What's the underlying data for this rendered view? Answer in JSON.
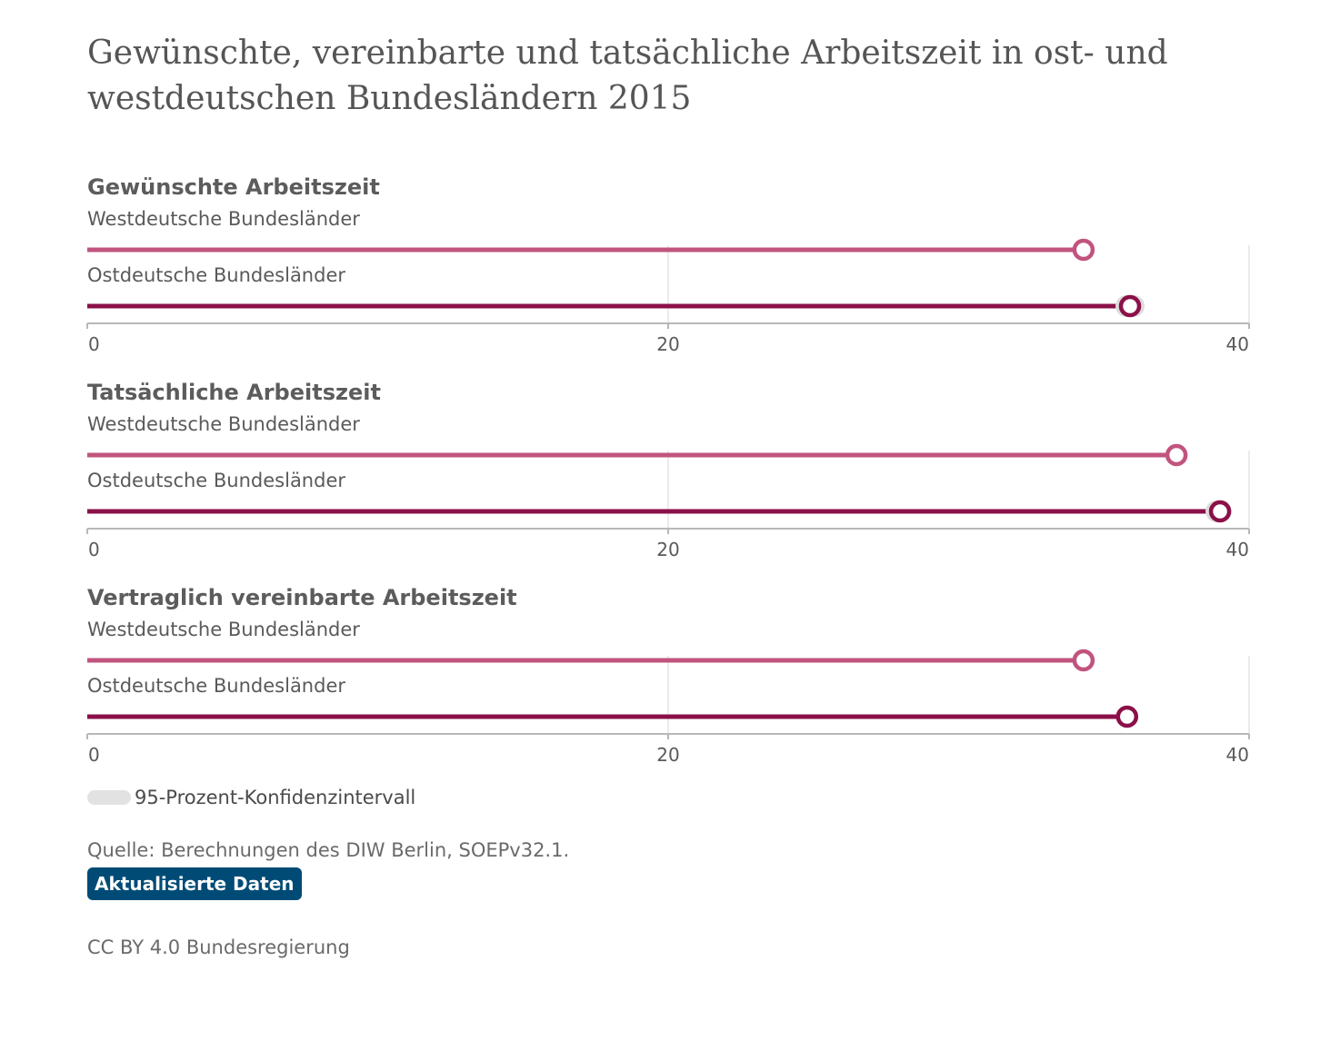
{
  "title": "Gewünschte, vereinbarte und tatsächliche Arbeitszeit in ost- und westdeutschen Bundesländern 2015",
  "colors": {
    "west": "#c1547e",
    "ost": "#8b1049",
    "ci": "#dcdcdc",
    "grid": "#e4e4e4",
    "axis": "#b8b8b8"
  },
  "chart_data": [
    {
      "type": "dot",
      "title": "Gewünschte Arbeitszeit",
      "xlim": [
        0,
        40
      ],
      "ticks": [
        "0",
        "20",
        "40"
      ],
      "series": [
        {
          "name": "Westdeutsche Bundesländer",
          "value": 34.3
        },
        {
          "name": "Ostdeutsche Bundesländer",
          "value": 35.9,
          "ci": [
            35.4,
            36.4
          ]
        }
      ]
    },
    {
      "type": "dot",
      "title": "Tatsächliche Arbeitszeit",
      "xlim": [
        0,
        40
      ],
      "ticks": [
        "0",
        "20",
        "40"
      ],
      "series": [
        {
          "name": "Westdeutsche Bundesländer",
          "value": 37.5
        },
        {
          "name": "Ostdeutsche Bundesländer",
          "value": 39.0,
          "ci": [
            38.5,
            39.4
          ]
        }
      ]
    },
    {
      "type": "dot",
      "title": "Vertraglich vereinbarte Arbeitszeit",
      "xlim": [
        0,
        40
      ],
      "ticks": [
        "0",
        "20",
        "40"
      ],
      "series": [
        {
          "name": "Westdeutsche Bundesländer",
          "value": 34.3
        },
        {
          "name": "Ostdeutsche Bundesländer",
          "value": 35.8
        }
      ]
    }
  ],
  "legend": {
    "label": "95-Prozent-Konfidenzintervall"
  },
  "source": "Quelle: Berechnungen des DIW Berlin, SOEPv32.1.",
  "badge": "Aktualisierte Daten",
  "license": "CC BY 4.0 Bundesregierung"
}
